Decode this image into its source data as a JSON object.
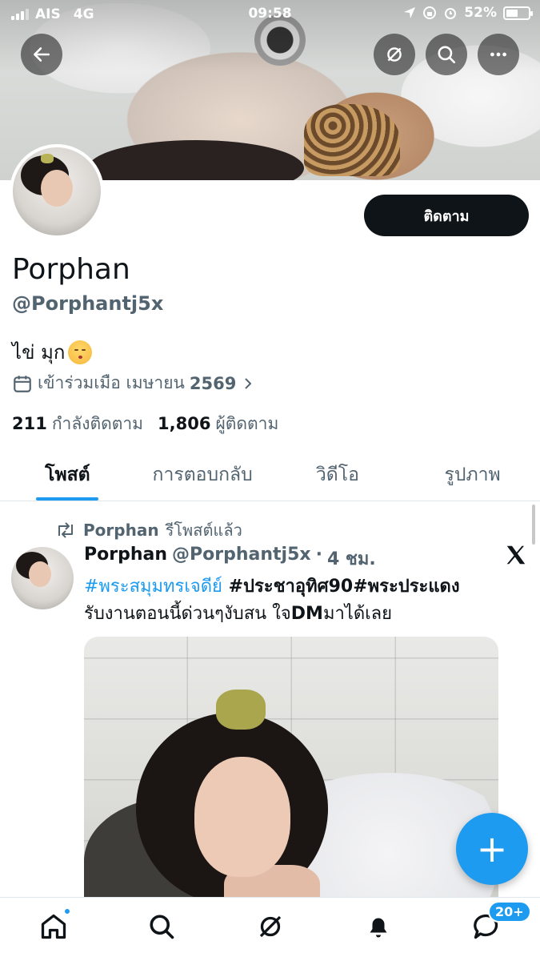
{
  "status_bar": {
    "carrier": "AIS",
    "network": "4G",
    "time": "09:58",
    "battery_percent_label": "52%",
    "battery_level": 0.52
  },
  "profile": {
    "follow_label": "ติดตาม",
    "display_name": "Porphan",
    "handle": "@Porphantj5x",
    "bio": "ไข่ มุก",
    "joined_prefix": "เข้าร่วมเมือ เมษายน",
    "joined_year": "2569",
    "following_count": "211",
    "following_label": "กำลังติดตาม",
    "followers_count": "1,806",
    "followers_label": "ผู้ติดตาม"
  },
  "tabs": [
    {
      "label": "โพสต์",
      "active": true
    },
    {
      "label": "การตอบกลับ",
      "active": false
    },
    {
      "label": "วิดีโอ",
      "active": false
    },
    {
      "label": "รูปภาพ",
      "active": false
    }
  ],
  "post": {
    "repost_name": "Porphan",
    "repost_label": "รีโพสต์แล้ว",
    "author_name": "Porphan",
    "author_handle": "@Porphantj5x",
    "separator": "·",
    "time": "4 ชม.",
    "hashtag1": "#พระสมุมทรเจดีย์",
    "text1": " #ประชาอุทิศ",
    "num1": "90",
    "text2": "#พระประแดง",
    "line2a": "รับงานตอนนี้ด่วนๆงับสน ใจ",
    "dm": "DM",
    "line2b": "มาได้เลย"
  },
  "fab": {
    "label": "+"
  },
  "nav": {
    "messages_badge": "20+"
  },
  "colors": {
    "accent": "#1d9bf0",
    "text": "#0f1419",
    "secondary": "#536471"
  },
  "icons": [
    "back-arrow-icon",
    "grok-icon",
    "search-icon",
    "more-icon",
    "calendar-icon",
    "chevron-right-icon",
    "repost-icon",
    "x-logo-icon",
    "home-icon",
    "search-nav-icon",
    "grok-nav-icon",
    "bell-icon",
    "messages-icon"
  ]
}
